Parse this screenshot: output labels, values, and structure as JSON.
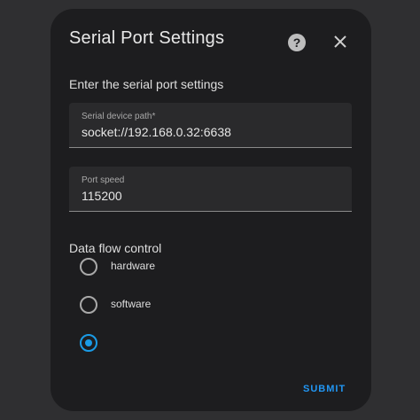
{
  "dialog": {
    "title": "Serial Port Settings",
    "subtitle": "Enter the serial port settings",
    "help_icon": "help-circle-icon",
    "close_icon": "close-icon"
  },
  "fields": [
    {
      "label": "Serial device path*",
      "value": "socket://192.168.0.32:6638"
    },
    {
      "label": "Port speed",
      "value": "115200"
    }
  ],
  "flow_control": {
    "label": "Data flow control",
    "options": [
      {
        "label": "hardware",
        "checked": false
      },
      {
        "label": "software",
        "checked": false
      },
      {
        "label": "",
        "checked": true
      }
    ]
  },
  "actions": {
    "submit_label": "SUBMIT"
  },
  "colors": {
    "accent": "#2196f3",
    "dialog_bg": "#1d1d1f",
    "page_bg": "#2f2f31"
  }
}
